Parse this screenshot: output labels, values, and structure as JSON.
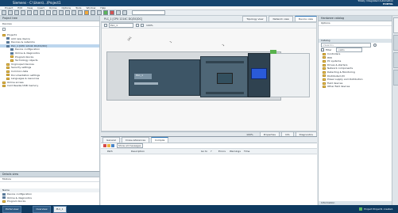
{
  "window": {
    "title": "Siemens - C:\\Users\\...\\Project1"
  },
  "brand": {
    "line1": "Totally Integrated Automation",
    "line2": "PORTAL"
  },
  "menu": [
    "Project",
    "Edit",
    "View",
    "Insert",
    "Online",
    "Options",
    "Tools",
    "Window",
    "Help"
  ],
  "tree": {
    "header": "Project tree",
    "section": "Devices",
    "items": [
      {
        "label": "Project1",
        "level": 0,
        "icon": "folder"
      },
      {
        "label": "Add new device",
        "level": 1,
        "icon": "device"
      },
      {
        "label": "Devices & networks",
        "level": 1,
        "icon": "device"
      },
      {
        "label": "PLC_1 [CPU 1214C DC/DC/DC]",
        "level": 1,
        "icon": "device",
        "selected": true
      },
      {
        "label": "Device configuration",
        "level": 2,
        "icon": "device"
      },
      {
        "label": "Online & diagnostics",
        "level": 2,
        "icon": "device"
      },
      {
        "label": "Program blocks",
        "level": 2,
        "icon": "folder"
      },
      {
        "label": "Technology objects",
        "level": 2,
        "icon": "folder"
      },
      {
        "label": "Ungrouped devices",
        "level": 1,
        "icon": "folder"
      },
      {
        "label": "Security settings",
        "level": 1,
        "icon": "folder"
      },
      {
        "label": "Common data",
        "level": 1,
        "icon": "folder"
      },
      {
        "label": "Documentation settings",
        "level": 1,
        "icon": "folder"
      },
      {
        "label": "Languages & resources",
        "level": 1,
        "icon": "folder"
      },
      {
        "label": "Online access",
        "level": 0,
        "icon": "folder"
      },
      {
        "label": "Card Reader/USB memory",
        "level": 0,
        "icon": "folder"
      }
    ]
  },
  "details": {
    "header": "Details view",
    "module_label": "Module",
    "name_label": "Name",
    "items": [
      "Device configuration",
      "Online & diagnostics",
      "Program blocks"
    ]
  },
  "editor": {
    "tab_label": "PLC_1 [CPU 1214C DC/DC/DC]",
    "view_tabs": [
      "Topology view",
      "Network view",
      "Device view"
    ],
    "device_dropdown": "PLC_1",
    "zoom": "100%",
    "slot_labels": [
      "101",
      "1",
      "2"
    ],
    "plc_name": "PLC_1"
  },
  "inspector": {
    "tabs": [
      "Properties",
      "Info",
      "Diagnostics"
    ],
    "subtabs": [
      "General",
      "Cross-references",
      "Compile"
    ],
    "filter_label": "Show all messages",
    "columns": [
      "Path",
      "Description",
      "Go to",
      "?",
      "Errors",
      "Warnings",
      "Time"
    ]
  },
  "taskcard": {
    "header": "Hardware catalog",
    "options_label": "Options",
    "catalog_label": "Catalog",
    "search_placeholder": "<Search>",
    "filter_label": "Filter",
    "profile_label": "<All>",
    "items": [
      "Controllers",
      "HMI",
      "PC systems",
      "Drives & starters",
      "Network components",
      "Detecting & Monitoring",
      "Distributed I/O",
      "Power supply and distribution",
      "Field devices",
      "Other field devices"
    ],
    "info_label": "Information"
  },
  "side_tabs": [
    "Hardware catalog",
    "Online tools",
    "Tasks",
    "Libraries"
  ],
  "bottombar": {
    "portal_view": "Portal view",
    "overview": "Overview",
    "plc_tab": "PLC_1",
    "status": "Project Project1 created."
  }
}
